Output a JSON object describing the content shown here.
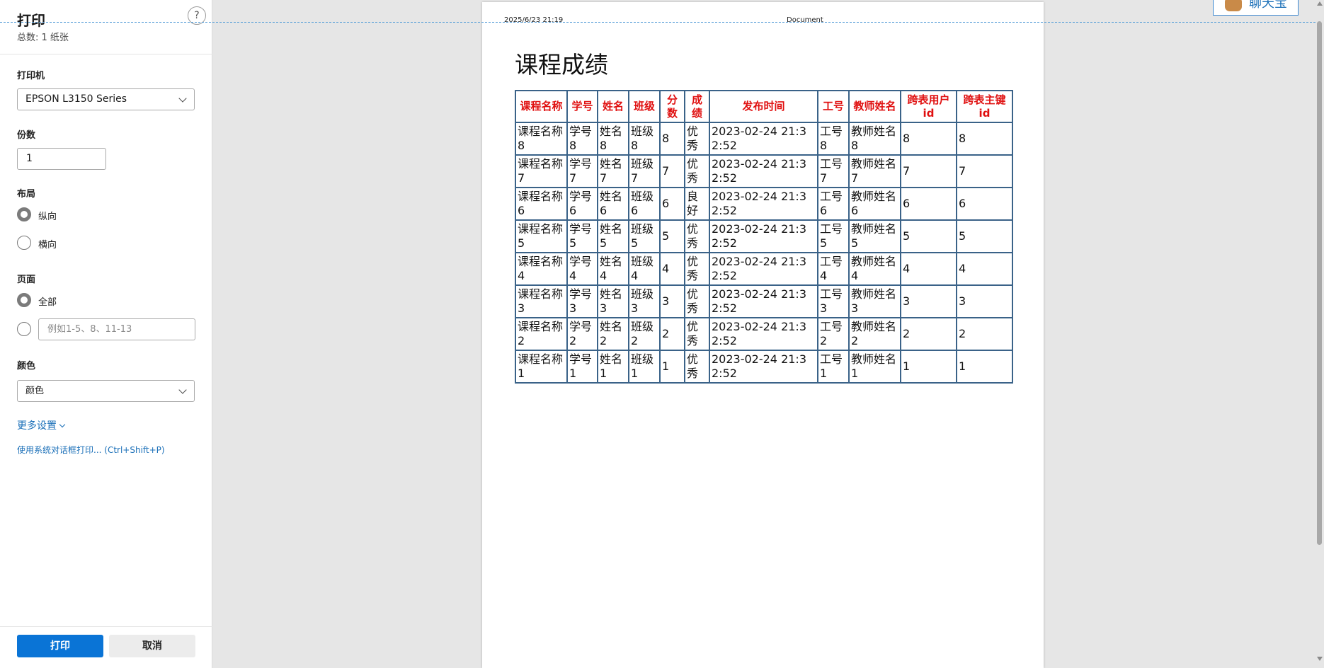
{
  "panel": {
    "title": "打印",
    "sheet_count": "总数: 1 纸张",
    "help_icon": "?",
    "printer_label": "打印机",
    "printer_value": "EPSON L3150 Series",
    "copies_label": "份数",
    "copies_value": "1",
    "layout_label": "布局",
    "layout_options": [
      "纵向",
      "横向"
    ],
    "layout_selected": "纵向",
    "pages_label": "页面",
    "pages_all": "全部",
    "pages_range_placeholder": "例如1-5、8、11-13",
    "color_label": "颜色",
    "color_value": "颜色",
    "more_settings": "更多设置",
    "system_dialog": "使用系统对话框打印... (Ctrl+Shift+P)",
    "print_button": "打印",
    "cancel_button": "取消"
  },
  "preview": {
    "header_date": "2025/6/23 21:19",
    "header_title": "Document",
    "doc_title": "课程成绩",
    "columns": [
      "课程名称",
      "学号",
      "姓名",
      "班级",
      "分数",
      "成绩",
      "发布时间",
      "工号",
      "教师姓名",
      "跨表用户id",
      "跨表主键id"
    ],
    "rows": [
      [
        "课程名称8",
        "学号8",
        "姓名8",
        "班级8",
        "8",
        "优秀",
        "2023-02-24 21:32:52",
        "工号8",
        "教师姓名8",
        "8",
        "8"
      ],
      [
        "课程名称7",
        "学号7",
        "姓名7",
        "班级7",
        "7",
        "优秀",
        "2023-02-24 21:32:52",
        "工号7",
        "教师姓名7",
        "7",
        "7"
      ],
      [
        "课程名称6",
        "学号6",
        "姓名6",
        "班级6",
        "6",
        "良好",
        "2023-02-24 21:32:52",
        "工号6",
        "教师姓名6",
        "6",
        "6"
      ],
      [
        "课程名称5",
        "学号5",
        "姓名5",
        "班级5",
        "5",
        "优秀",
        "2023-02-24 21:32:52",
        "工号5",
        "教师姓名5",
        "5",
        "5"
      ],
      [
        "课程名称4",
        "学号4",
        "姓名4",
        "班级4",
        "4",
        "优秀",
        "2023-02-24 21:32:52",
        "工号4",
        "教师姓名4",
        "4",
        "4"
      ],
      [
        "课程名称3",
        "学号3",
        "姓名3",
        "班级3",
        "3",
        "优秀",
        "2023-02-24 21:32:52",
        "工号3",
        "教师姓名3",
        "3",
        "3"
      ],
      [
        "课程名称2",
        "学号2",
        "姓名2",
        "班级2",
        "2",
        "优秀",
        "2023-02-24 21:32:52",
        "工号2",
        "教师姓名2",
        "2",
        "2"
      ],
      [
        "课程名称1",
        "学号1",
        "姓名1",
        "班级1",
        "1",
        "优秀",
        "2023-02-24 21:32:52",
        "工号1",
        "教师姓名1",
        "1",
        "1"
      ]
    ]
  },
  "chat_widget": {
    "label": "聊天宝",
    "icon": "bear-mascot-icon"
  },
  "colors": {
    "accent": "#0a74d6",
    "header_text": "#e01010",
    "table_border": "#3a6288",
    "link": "#1a6fb8"
  }
}
